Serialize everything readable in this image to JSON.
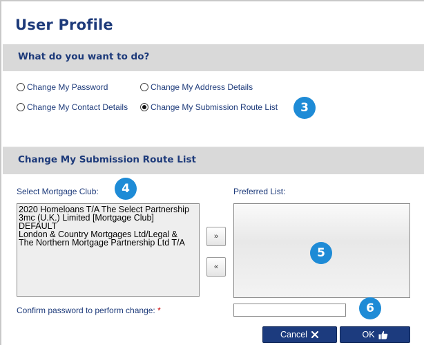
{
  "page": {
    "title": "User Profile"
  },
  "sections": {
    "action": {
      "heading": "What do you want to do?"
    },
    "route": {
      "heading": "Change My Submission Route List"
    }
  },
  "options": [
    {
      "label": "Change My Password",
      "selected": false
    },
    {
      "label": "Change My Address Details",
      "selected": false
    },
    {
      "label": "Change My Contact Details",
      "selected": false
    },
    {
      "label": "Change My Submission Route List",
      "selected": true
    }
  ],
  "badges": [
    "3",
    "4",
    "5",
    "6"
  ],
  "club_list": {
    "label": "Select Mortgage Club:",
    "items": [
      "2020 Homeloans T/A The Select Partnership",
      "3mc (U.K.) Limited [Mortgage Club]",
      "DEFAULT",
      "London & Country Mortgages Ltd/Legal &",
      "The Northern Mortgage Partnership Ltd T/A"
    ]
  },
  "preferred_list": {
    "label": "Preferred List:",
    "items": []
  },
  "move": {
    "add": "»",
    "remove": "«"
  },
  "confirm": {
    "label": "Confirm password to perform change:",
    "required_mark": "*",
    "value": ""
  },
  "buttons": {
    "cancel": "Cancel",
    "ok": "OK"
  },
  "colors": {
    "brand_navy": "#1d3a7a",
    "badge_blue": "#1e8bd6",
    "section_gray": "#d9d9d9",
    "button_navy": "#1c3b7e",
    "required_red": "#cc0000"
  }
}
